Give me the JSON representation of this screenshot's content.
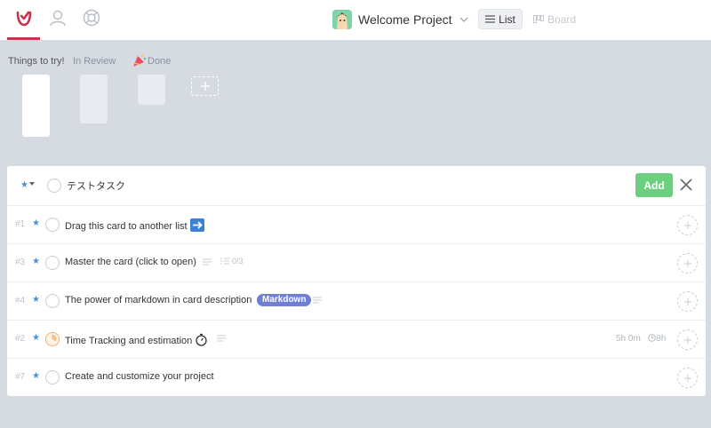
{
  "colors": {
    "accent_red": "#c8324a",
    "add_green": "#6ccf7f",
    "star_blue": "#4a90d9",
    "badge_purple": "#6f7fd4",
    "background": "#d6dbe2"
  },
  "nav": {
    "items": [
      {
        "icon": "app-logo-icon",
        "active": true
      },
      {
        "icon": "user-icon",
        "active": false
      },
      {
        "icon": "lifebuoy-icon",
        "active": false
      }
    ]
  },
  "project": {
    "title": "Welcome Project",
    "avatar_icon": "project-avatar-icon"
  },
  "views": {
    "list_label": "List",
    "board_label": "Board",
    "active": "List"
  },
  "board_columns": [
    {
      "title": "Things to try!"
    },
    {
      "title": "In Review"
    },
    {
      "title": "Done",
      "icon": "party-popper-icon"
    }
  ],
  "new_task": {
    "value": "テストタスク",
    "add_label": "Add"
  },
  "tasks": [
    {
      "id": "#1",
      "title": "Drag this card to another list",
      "emoji": "➡️"
    },
    {
      "id": "#3",
      "title": "Master the card (click to open)",
      "checklist": "0/3"
    },
    {
      "id": "#4",
      "title": "The power of markdown in card description",
      "badge": "Markdown"
    },
    {
      "id": "#2",
      "title": "Time Tracking and estimation",
      "emoji": "⏱️",
      "time_spent": "5h 0m",
      "estimate": "8h"
    },
    {
      "id": "#7",
      "title": "Create and customize your project"
    }
  ]
}
